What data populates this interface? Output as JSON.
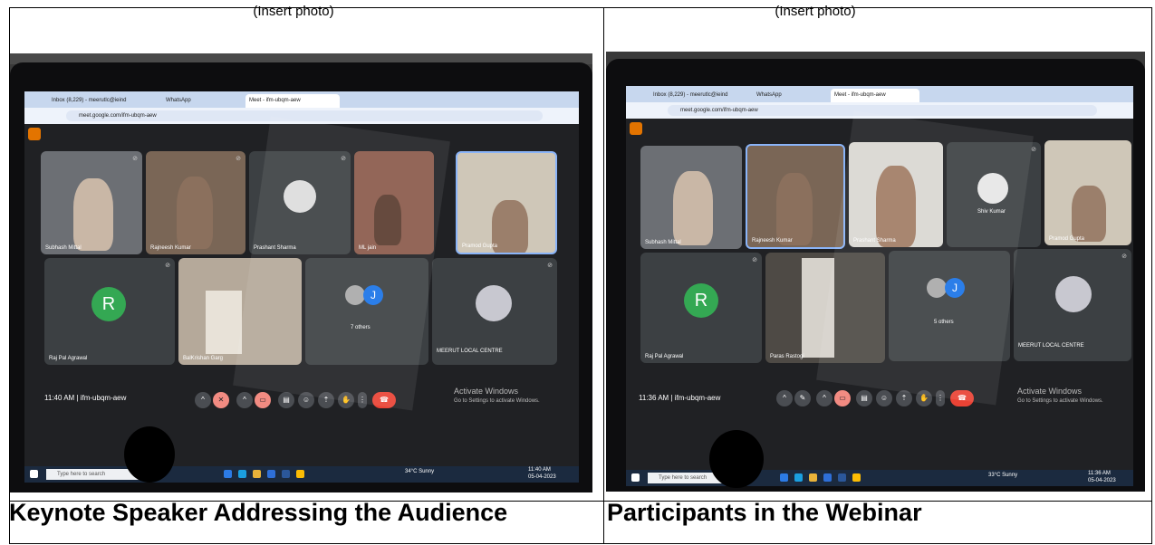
{
  "placeholders": {
    "left": "(Insert photo)",
    "right": "(Insert photo)"
  },
  "captions": {
    "left": "Keynote Speaker Addressing the Audience",
    "right": "Participants in the Webinar"
  },
  "left_photo": {
    "tabs": [
      "Inbox (8,229) - meerutlc@ieind",
      "WhatsApp",
      "Meet - ifm-ubqm-aew"
    ],
    "url": "meet.google.com/ifm-ubqm-aew",
    "participants_row1": [
      "Subhash Mittal",
      "Rajneesh Kumar",
      "Prashant Sharma",
      "ML jain",
      "Pramod Gupta"
    ],
    "participants_row2": [
      "Raj Pal Agrawal",
      "BalKrishan Garg",
      "7 others",
      "MEERUT LOCAL CENTRE"
    ],
    "avatar_letter": "R",
    "others_letter": "J",
    "meeting_info": "11:40 AM | ifm-ubqm-aew",
    "activate_title": "Activate Windows",
    "activate_sub": "Go to Settings to activate Windows.",
    "search_placeholder": "Type here to search",
    "weather": "34°C Sunny",
    "clock_time": "11:40 AM",
    "clock_date": "05-04-2023"
  },
  "right_photo": {
    "tabs": [
      "Inbox (8,229) - meerutlc@ieind",
      "WhatsApp",
      "Meet - ifm-ubqm-aew"
    ],
    "url": "meet.google.com/ifm-ubqm-aew",
    "participants_row1": [
      "Subhash Mittal",
      "Rajneesh Kumar",
      "Prashant Sharma",
      "Shiv Kumar",
      "Pramod Gupta"
    ],
    "participants_row2": [
      "Raj Pal Agrawal",
      "Paras Rastogi",
      "5 others",
      "MEERUT LOCAL CENTRE"
    ],
    "avatar_letter": "R",
    "others_letter": "J",
    "meeting_info": "11:36 AM | ifm-ubqm-aew",
    "activate_title": "Activate Windows",
    "activate_sub": "Go to Settings to activate Windows.",
    "search_placeholder": "Type here to search",
    "weather": "33°C Sunny",
    "clock_time": "11:36 AM",
    "clock_date": "05-04-2023"
  },
  "colors": {
    "avatar_green": "#34a853",
    "others_blue": "#1a73e8",
    "end_call_red": "#ea4335",
    "meet_background": "#202124"
  }
}
